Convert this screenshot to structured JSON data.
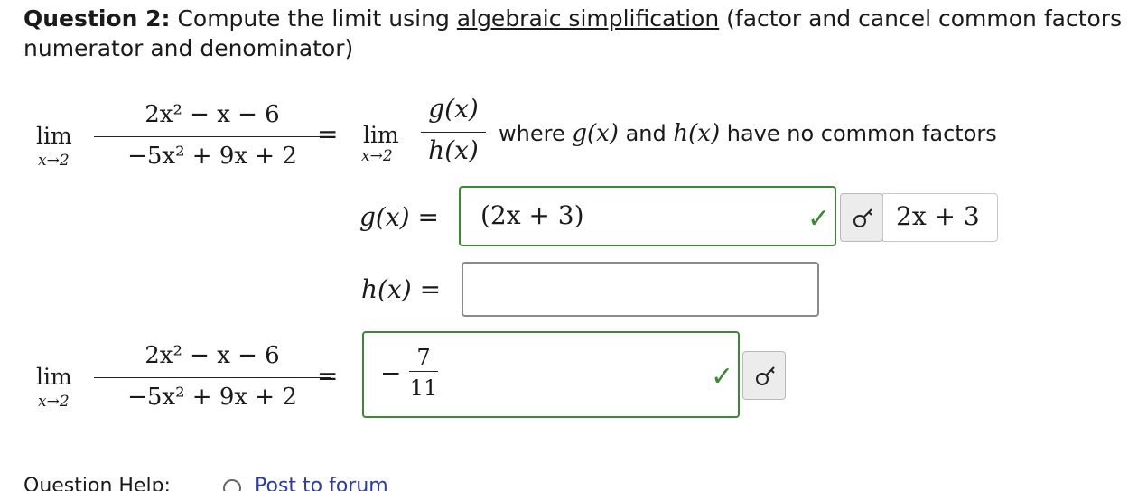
{
  "question": {
    "number_label": "Question 2:",
    "text_before": "Compute the limit using",
    "link_text": "algebraic simplification",
    "text_after": "(factor and cancel common factors",
    "line2": "numerator and denominator)"
  },
  "limit1": {
    "lim": "lim",
    "sub": "x→2",
    "numerator": "2x² − x − 6",
    "denominator": "−5x² + 9x + 2",
    "equals": "="
  },
  "limit_rhs": {
    "lim": "lim",
    "sub": "x→2",
    "numerator": "g(x)",
    "denominator": "h(x)",
    "where_text": "where",
    "g_inline": "g(x)",
    "and_text": "and",
    "h_inline": "h(x)",
    "tail_text": "have no common factors"
  },
  "g_row": {
    "label": "g(x)",
    "equals": "=",
    "value": "(2x + 3)",
    "status": "correct",
    "preview": "2x + 3"
  },
  "h_row": {
    "label": "h(x)",
    "equals": "=",
    "value": "",
    "status": "empty"
  },
  "limit2": {
    "lim": "lim",
    "sub": "x→2",
    "numerator": "2x² − x − 6",
    "denominator": "−5x² + 9x + 2",
    "equals": "=",
    "answer_sign": "−",
    "answer_num": "7",
    "answer_den": "11",
    "status": "correct"
  },
  "help": {
    "label": "Question Help:",
    "link": "Post to forum"
  },
  "colors": {
    "correct": "#3a8a2f",
    "link": "#2a3aa8",
    "empty_border": "#8a8a8a"
  },
  "icons": {
    "check": "check-icon",
    "key": "key-icon"
  }
}
